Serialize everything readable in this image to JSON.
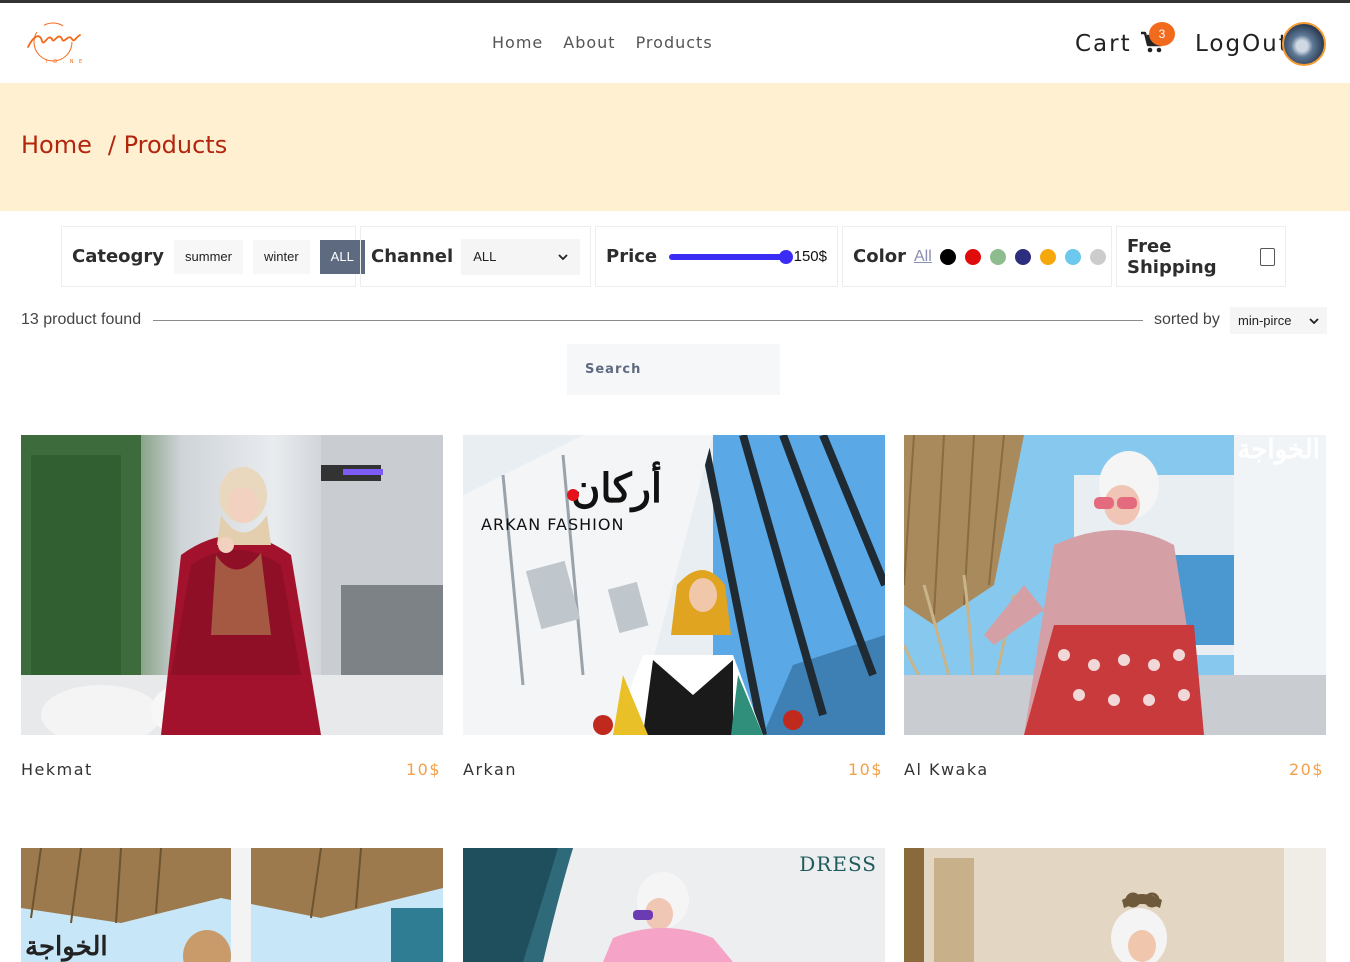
{
  "header": {
    "logo_text": "Galaleeb",
    "nav": [
      "Home",
      "About",
      "Products"
    ],
    "cart_label": "Cart",
    "cart_count": "3",
    "logout_label": "LogOut"
  },
  "breadcrumb": {
    "home": "Home",
    "current": "/ Products"
  },
  "filters": {
    "category_label": "Cateogry",
    "categories": [
      "summer",
      "winter",
      "ALL"
    ],
    "active_category": "ALL",
    "channel_label": "Channel",
    "channel_value": "ALL",
    "price_label": "Price",
    "price_value": "150$",
    "price_fraction": 1.0,
    "color_label": "Color",
    "color_all": "All",
    "colors": [
      "#000000",
      "#e00b0b",
      "#8fbc8f",
      "#2d2f7e",
      "#f5a80c",
      "#6cc8ec",
      "#cccccc"
    ],
    "free_shipping_label": "Free Shipping",
    "free_shipping_checked": false
  },
  "results": {
    "found_text": "13 product found",
    "sorted_label": "sorted by",
    "sort_value": "min-pirce"
  },
  "search": {
    "placeholder": "Search"
  },
  "products": [
    {
      "name": "Hekmat",
      "price": "10$"
    },
    {
      "name": "Arkan",
      "price": "10$"
    },
    {
      "name": "Al Kwaka",
      "price": "20$"
    }
  ],
  "image_text": {
    "arkan_logo": "ARKAN FASHION",
    "arkan_arabic": "أركان",
    "kwaka_arabic": "الخواجة",
    "dress_logo": "DRESS"
  },
  "theme": {
    "accent": "#f26b1d",
    "breadcrumb": "#b3260e",
    "banner_bg": "#fff0d1",
    "price": "#f3a04a",
    "slider": "#3b2cf5"
  }
}
